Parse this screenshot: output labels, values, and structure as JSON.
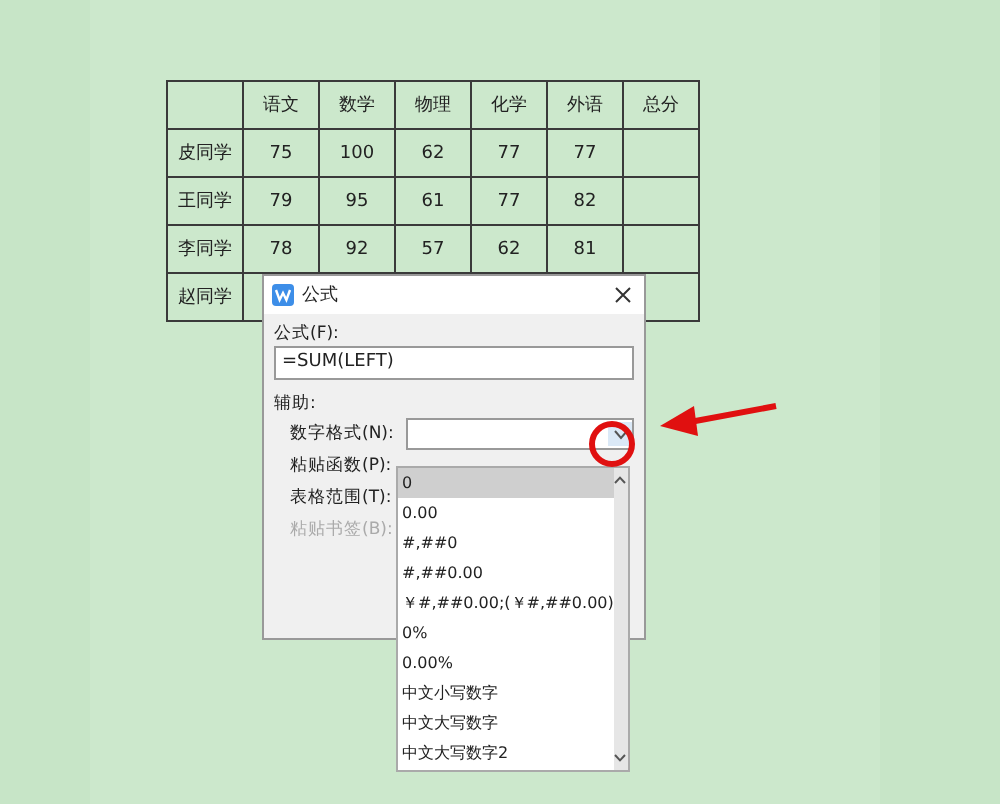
{
  "table": {
    "columns": [
      "语文",
      "数学",
      "物理",
      "化学",
      "外语",
      "总分"
    ],
    "rows": [
      {
        "name": "皮同学",
        "cells": [
          "75",
          "100",
          "62",
          "77",
          "77"
        ]
      },
      {
        "name": "王同学",
        "cells": [
          "79",
          "95",
          "61",
          "77",
          "82"
        ]
      },
      {
        "name": "李同学",
        "cells": [
          "78",
          "92",
          "57",
          "62",
          "81"
        ]
      },
      {
        "name": "赵同学",
        "cells": []
      }
    ]
  },
  "dialog": {
    "title": "公式",
    "formula_label": "公式(F):",
    "formula_value": "=SUM(LEFT)",
    "helper_label": "辅助:",
    "fields": [
      {
        "label": "数字格式(N):",
        "disabled": false
      },
      {
        "label": "粘贴函数(P):",
        "disabled": false
      },
      {
        "label": "表格范围(T):",
        "disabled": false
      },
      {
        "label": "粘贴书签(B):",
        "disabled": true
      }
    ],
    "dropdown": {
      "options": [
        {
          "label": "0",
          "selected": true
        },
        {
          "label": "0.00",
          "selected": false
        },
        {
          "label": "#,##0",
          "selected": false
        },
        {
          "label": "#,##0.00",
          "selected": false
        },
        {
          "label": "￥#,##0.00;(￥#,##0.00)",
          "selected": false
        },
        {
          "label": "0%",
          "selected": false
        },
        {
          "label": "0.00%",
          "selected": false
        },
        {
          "label": "中文小写数字",
          "selected": false
        },
        {
          "label": "中文大写数字",
          "selected": false
        },
        {
          "label": "中文大写数字2",
          "selected": false
        }
      ]
    }
  }
}
